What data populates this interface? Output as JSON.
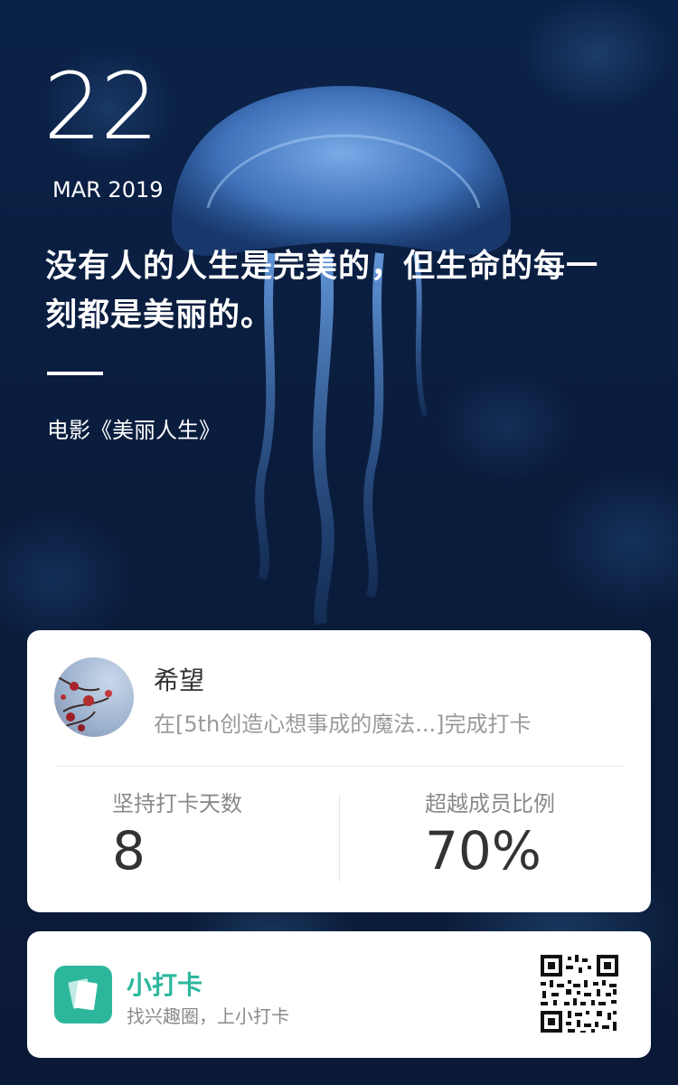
{
  "header": {
    "day": "22",
    "month_year": "MAR 2019",
    "quote_line1": "没有人的人生是完美的，但生命的每一",
    "quote_line2": "刻都是美丽的。",
    "source": "电影《美丽人生》"
  },
  "profile": {
    "name": "希望",
    "activity": "在[5th创造心想事成的魔法...]完成打卡"
  },
  "stats": {
    "days_label": "坚持打卡天数",
    "days_value": "8",
    "percent_label": "超越成员比例",
    "percent_value": "70%"
  },
  "brand": {
    "name": "小打卡",
    "slogan": "找兴趣圈，上小打卡",
    "accent": "#2cb79d"
  },
  "icons": {
    "app": "card-stack-icon",
    "qr": "qr-code-icon"
  }
}
